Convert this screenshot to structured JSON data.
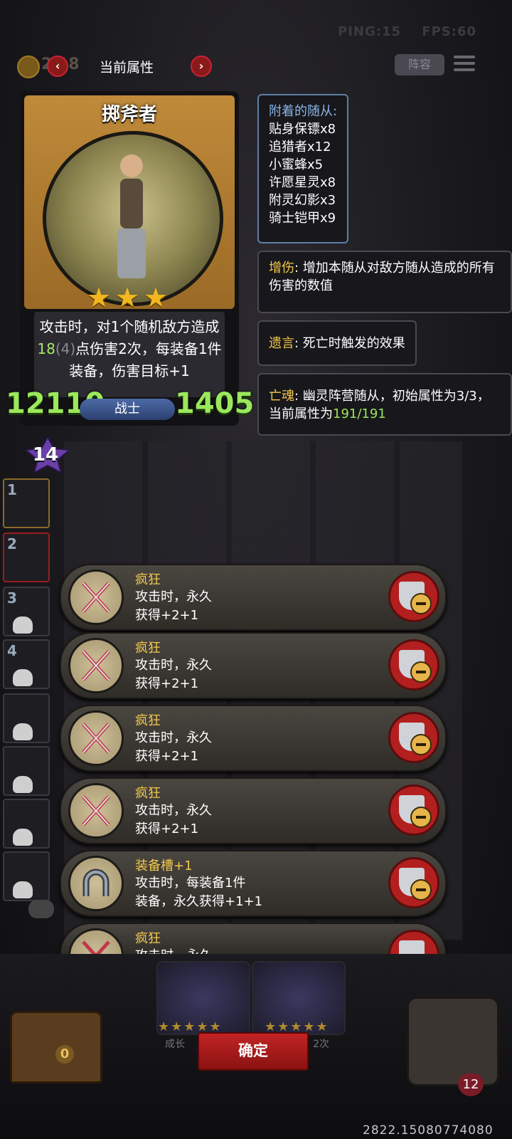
{
  "topbar": {
    "ping": "PING:15",
    "fps": "FPS:60",
    "coin_value": "2 18",
    "title": "当前属性",
    "prev_arrow": "‹",
    "next_arrow": "›",
    "lineup_label": "阵容"
  },
  "card": {
    "name": "掷斧者",
    "star_count": 3,
    "stars": "★★★",
    "desc_part1": "攻击时，对1个随机敌方造成",
    "desc_damage": "18",
    "desc_bonus": "(4)",
    "desc_part2": "点伤害2次，每装备1件装备，伤害目标+1",
    "attack": "12110",
    "health": "1405",
    "class": "战士",
    "level": "14"
  },
  "info": {
    "attached_header": "附着的随从:",
    "attached": [
      "贴身保镖x8",
      "追猎者x12",
      "小蜜蜂x5",
      "许愿星灵x8",
      "附灵幻影x3",
      "骑士铠甲x9"
    ],
    "damage_kw": "增伤",
    "damage_text": ": 增加本随从对敌方随从造成的所有伤害的数值",
    "deathrattle_kw": "遗言",
    "deathrattle_text": ": 死亡时触发的效果",
    "soul_kw": "亡魂",
    "soul_text": ": 幽灵阵营随从，初始属性为3/3，当前属性为",
    "soul_value": "191/191"
  },
  "slots": [
    "1",
    "2",
    "3",
    "4",
    "",
    "",
    "",
    ""
  ],
  "items": [
    {
      "name": "疯狂",
      "l1": "攻击时，永久",
      "l2": "获得+2+1",
      "icon": "crossed-daggers-icon"
    },
    {
      "name": "疯狂",
      "l1": "攻击时，永久",
      "l2": "获得+2+1",
      "icon": "crossed-daggers-icon"
    },
    {
      "name": "疯狂",
      "l1": "攻击时，永久",
      "l2": "获得+2+1",
      "icon": "crossed-daggers-icon"
    },
    {
      "name": "疯狂",
      "l1": "攻击时，永久",
      "l2": "获得+2+1",
      "icon": "crossed-daggers-icon"
    },
    {
      "name": "装备槽+1",
      "l1": "攻击时，每装备1件",
      "l2": "装备，永久获得+1+1",
      "icon": "horseshoe-icon"
    },
    {
      "name": "疯狂",
      "l1": "攻击时，永久",
      "l2": "",
      "icon": "crossed-daggers-icon"
    }
  ],
  "bottom": {
    "confirm_label": "确定",
    "chest_count": "0",
    "lives": "12",
    "footer_number": "2822.15080774080",
    "mini_left_text": "成长",
    "mini_right_text": "2次"
  },
  "colors": {
    "accent_green": "#9be85c",
    "keyword_yellow": "#f2c84b",
    "confirm_red": "#c22424"
  }
}
